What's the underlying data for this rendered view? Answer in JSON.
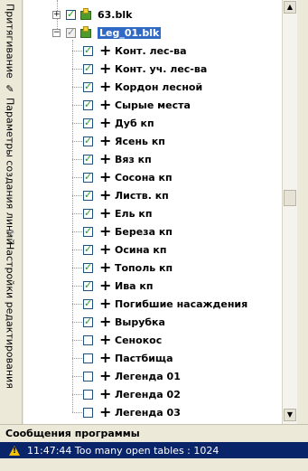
{
  "sidebar": {
    "tab_snap": "Притягивание",
    "tab_line": "Параметры создания линий",
    "tab_edit": "Настройки редактирования"
  },
  "tree": {
    "parent1": {
      "label": "63.blk",
      "checked": true
    },
    "parent2": {
      "label": "Leg_01.blk",
      "checked": true
    },
    "layers": [
      {
        "label": "Конт. лес-ва",
        "checked": true
      },
      {
        "label": "Конт. уч. лес-ва",
        "checked": true
      },
      {
        "label": "Кордон лесной",
        "checked": true
      },
      {
        "label": "Сырые места",
        "checked": true
      },
      {
        "label": "Дуб кп",
        "checked": true
      },
      {
        "label": "Ясень кп",
        "checked": true
      },
      {
        "label": "Вяз кп",
        "checked": true
      },
      {
        "label": "Сосона кп",
        "checked": true
      },
      {
        "label": "Листв. кп",
        "checked": true
      },
      {
        "label": "Ель кп",
        "checked": true
      },
      {
        "label": "Береза кп",
        "checked": true
      },
      {
        "label": "Осина кп",
        "checked": true
      },
      {
        "label": "Тополь кп",
        "checked": true
      },
      {
        "label": "Ива кп",
        "checked": true
      },
      {
        "label": "Погибшие насаждения",
        "checked": true
      },
      {
        "label": "Вырубка",
        "checked": true
      },
      {
        "label": "Сенокос",
        "checked": false
      },
      {
        "label": "Пастбища",
        "checked": false
      },
      {
        "label": "Легенда 01",
        "checked": false
      },
      {
        "label": "Легенда 02",
        "checked": false
      },
      {
        "label": "Легенда 03",
        "checked": false
      }
    ]
  },
  "messages": {
    "title": "Сообщения программы",
    "row": "11:47:44 Too many open tables :  1024"
  },
  "colors": {
    "selection": "#316ac5",
    "check": "#21a121",
    "message_bg": "#0a246a"
  }
}
